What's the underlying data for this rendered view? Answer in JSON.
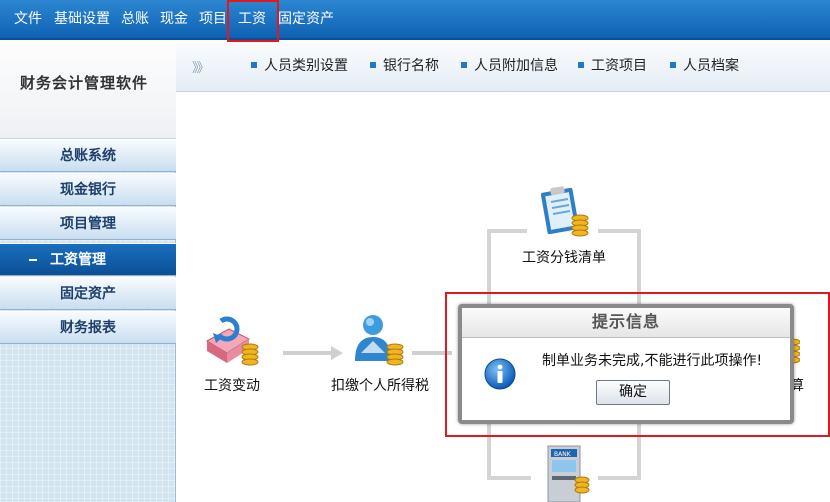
{
  "menu": {
    "items": [
      "文件",
      "基础设置",
      "总账",
      "现金",
      "项目",
      "工资",
      "固定资产"
    ]
  },
  "sidebar": {
    "logo_text": "财务会计管理软件",
    "items": [
      {
        "label": "总账系统",
        "active": false
      },
      {
        "label": "现金银行",
        "active": false
      },
      {
        "label": "项目管理",
        "active": false
      },
      {
        "label": "工资管理",
        "active": true
      },
      {
        "label": "固定资产",
        "active": false
      },
      {
        "label": "财务报表",
        "active": false
      }
    ]
  },
  "toolbar": {
    "chevron": "》》",
    "items": [
      "人员类别设置",
      "银行名称",
      "人员附加信息",
      "工资项目",
      "人员档案"
    ]
  },
  "flow": {
    "salary_change": "工资变动",
    "withhold_tax": "扣缴个人所得税",
    "salary_split": "工资分钱清单",
    "partial_right": "算"
  },
  "dialog": {
    "title": "提示信息",
    "message": "制单业务未完成,不能进行此项操作!",
    "ok_label": "确定"
  },
  "colors": {
    "menu_bar": "#1a73c4",
    "highlight": "#e0191e",
    "nav_active": "#0f5aa6"
  }
}
